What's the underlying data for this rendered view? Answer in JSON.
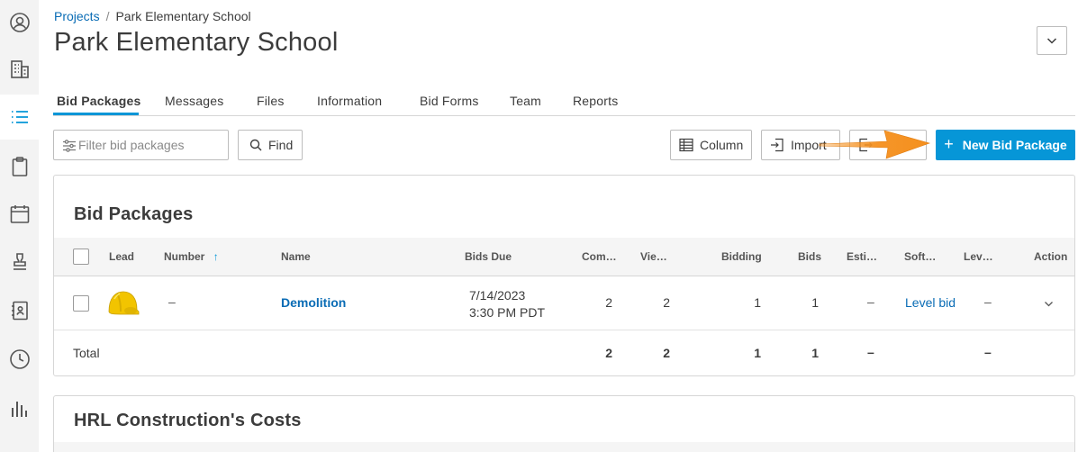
{
  "breadcrumb": {
    "root": "Projects",
    "separator": "/",
    "current": "Park Elementary School"
  },
  "page_title": "Park Elementary School",
  "tabs": [
    {
      "label": "Bid Packages",
      "active": true
    },
    {
      "label": "Messages"
    },
    {
      "label": "Files"
    },
    {
      "label": "Information"
    },
    {
      "label": "Bid Forms"
    },
    {
      "label": "Team"
    },
    {
      "label": "Reports"
    }
  ],
  "toolbar": {
    "filter_placeholder": "Filter bid packages",
    "find_label": "Find",
    "column_label": "Column",
    "import_label": "Import",
    "new_label": "New Bid Package"
  },
  "bid_packages": {
    "title": "Bid Packages",
    "columns": [
      "Lead",
      "Number",
      "Name",
      "Bids Due",
      "Com…",
      "Vie…",
      "Bidding",
      "Bids",
      "Esti…",
      "Soft…",
      "Lev…",
      "Action"
    ],
    "sort_indicator": "↑",
    "rows": [
      {
        "number": "–",
        "name": "Demolition",
        "bids_due_date": "7/14/2023",
        "bids_due_time": "3:30 PM PDT",
        "committed": "2",
        "viewed": "2",
        "bidding": "1",
        "bids": "1",
        "estimate": "–",
        "software": "Level bid",
        "leveled": "–"
      }
    ],
    "total": {
      "label": "Total",
      "committed": "2",
      "viewed": "2",
      "bidding": "1",
      "bids": "1",
      "estimate": "–",
      "leveled": "–"
    }
  },
  "costs": {
    "title": "HRL Construction's Costs"
  },
  "colors": {
    "accent": "#0696d7",
    "link": "#0a6cb5",
    "annotation": "#f5901e",
    "hardhat": "#f2c400"
  },
  "icons": [
    "user-circle-icon",
    "building-icon",
    "list-icon",
    "clipboard-icon",
    "calendar-icon",
    "stamp-icon",
    "address-book-icon",
    "clock-icon",
    "bar-chart-icon"
  ]
}
